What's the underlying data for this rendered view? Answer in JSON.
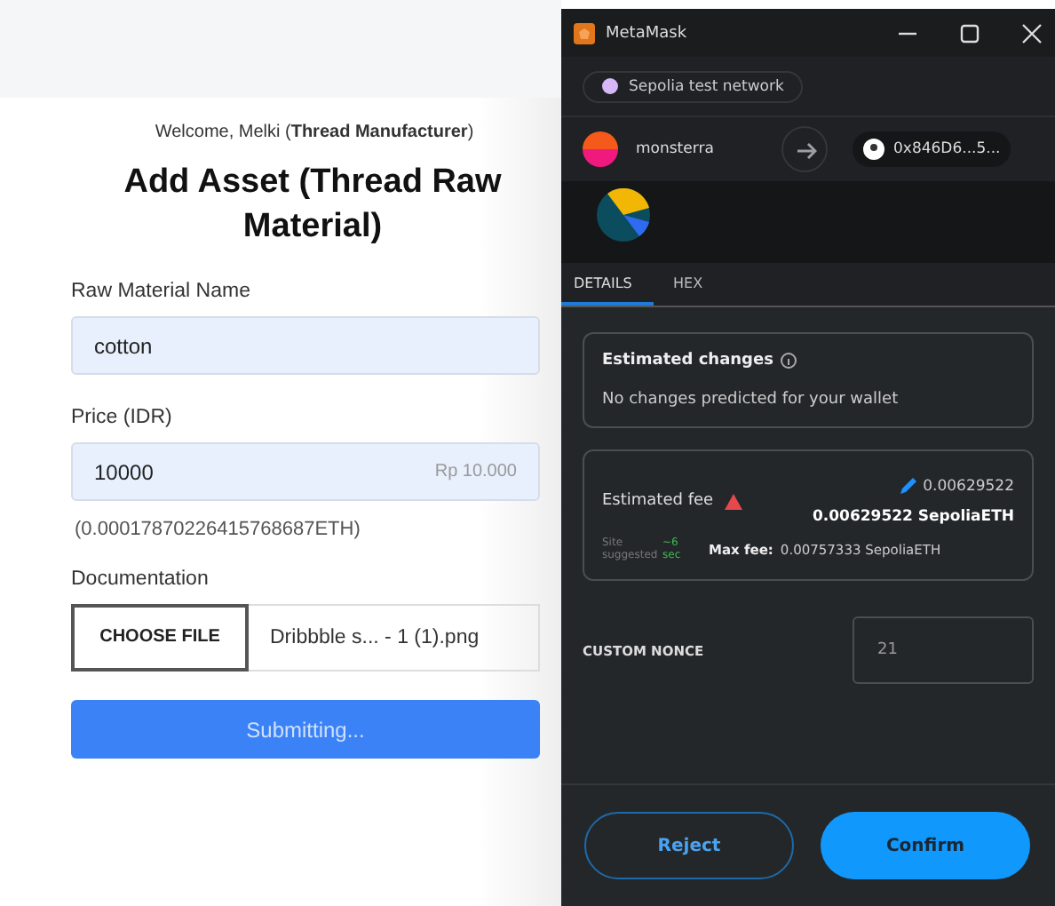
{
  "page": {
    "welcome": "Welcome, Melki (**Thread Manufacturer**)",
    "title": "Add Asset (Thread Raw Material)",
    "fields": [
      {
        "kind": "text",
        "label": "Raw Material Name",
        "value": "cotton"
      },
      {
        "kind": "price",
        "label": "Price (IDR)",
        "value": "10000",
        "suffix": "Rp 10.000",
        "note": "(0.00017870226415768687ETH)"
      },
      {
        "kind": "file",
        "label": "Documentation",
        "button": "CHOOSE FILE",
        "file": "Dribbble s... - 1 (1).png"
      }
    ],
    "submit": {
      "label": "Submitting...",
      "disabled": true
    }
  },
  "wallet": {
    "window": {
      "title": "MetaMask"
    },
    "network": {
      "label": "Sepolia test network",
      "color": "#d5b8f5"
    },
    "from": {
      "name": "monsterra"
    },
    "to": {
      "address": "0x846D6...5..."
    },
    "tabs": [
      {
        "label": "DETAILS",
        "selected": true
      },
      {
        "label": "HEX",
        "selected": false
      }
    ],
    "changes": {
      "title": "Estimated changes",
      "text": "No changes predicted for your wallet"
    },
    "fee": {
      "label": "Estimated fee",
      "amount": "0.00629522",
      "total": "0.00629522 SepoliaETH",
      "source": "Site suggested",
      "time": "~6 sec",
      "max_label": "Max fee:",
      "max": "0.00757333 SepoliaETH"
    },
    "nonce": {
      "label": "CUSTOM NONCE",
      "value": "21"
    },
    "buttons": [
      {
        "kind": "secondary",
        "label": "Reject"
      },
      {
        "kind": "primary",
        "label": "Confirm"
      }
    ]
  }
}
